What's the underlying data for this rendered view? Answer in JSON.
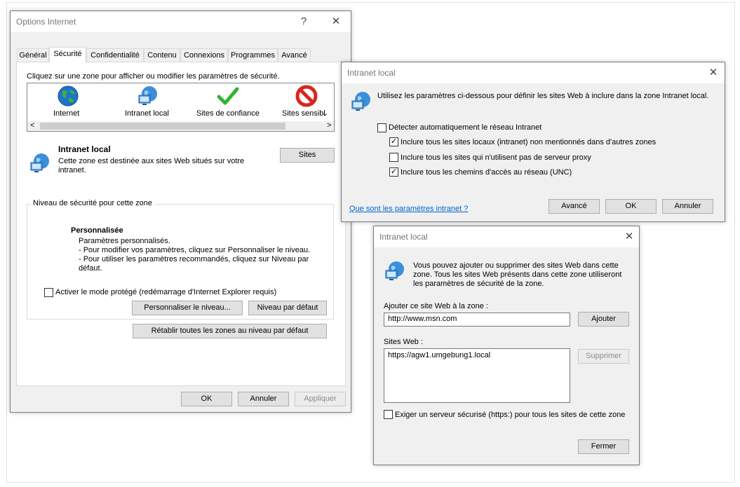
{
  "options_dialog": {
    "title": "Options Internet",
    "help_glyph": "?",
    "close_glyph": "✕",
    "tabs": [
      "Général",
      "Sécurité",
      "Confidentialité",
      "Contenu",
      "Connexions",
      "Programmes",
      "Avancé"
    ],
    "active_tab": "Sécurité",
    "zone_instruction": "Cliquez sur une zone pour afficher ou modifier les paramètres de sécurité.",
    "zones": [
      {
        "label": "Internet",
        "icon": "globe-icon"
      },
      {
        "label": "Intranet local",
        "icon": "intranet-globe-icon"
      },
      {
        "label": "Sites de confiance",
        "icon": "checkmark-icon"
      },
      {
        "label": "Sites sensibl",
        "icon": "restricted-icon"
      }
    ],
    "scroll_left": "<",
    "scroll_right": ">",
    "selected_zone_title": "Intranet local",
    "selected_zone_desc": "Cette zone est destinée aux sites Web situés sur votre intranet.",
    "sites_button": "Sites",
    "security_level_group": "Niveau de sécurité pour cette zone",
    "level_title": "Personnalisée",
    "level_lines": [
      "Paramètres personnalisés.",
      "- Pour modifier vos paramètres, cliquez sur Personnaliser le niveau.",
      "- Pour utiliser les paramètres recommandés, cliquez sur Niveau par défaut."
    ],
    "protected_mode_label": "Activer le mode protégé (redémarrage d'Internet Explorer requis)",
    "protected_mode_checked": false,
    "customize_button": "Personnaliser le niveau...",
    "default_level_button": "Niveau par défaut",
    "reset_all_button": "Rétablir toutes les zones au niveau par défaut",
    "ok_button": "OK",
    "cancel_button": "Annuler",
    "apply_button": "Appliquer"
  },
  "intranet_dialog": {
    "title": "Intranet local",
    "close_glyph": "✕",
    "intro": "Utilisez les paramètres ci-dessous pour définir les sites Web à inclure dans la zone Intranet local.",
    "options": [
      {
        "label": "Détecter automatiquement le réseau Intranet",
        "checked": false
      },
      {
        "label": "Inclure tous les sites locaux (intranet) non mentionnés dans d'autres zones",
        "checked": true
      },
      {
        "label": "Inclure tous les sites qui n'utilisent pas de serveur proxy",
        "checked": false
      },
      {
        "label": "Inclure tous les chemins d'accès au réseau (UNC)",
        "checked": true
      }
    ],
    "help_link": "Que sont les paramètres intranet ?",
    "advanced_button": "Avancé",
    "ok_button": "OK",
    "cancel_button": "Annuler"
  },
  "sites_dialog": {
    "title": "Intranet local",
    "close_glyph": "✕",
    "intro": "Vous pouvez ajouter ou supprimer des sites Web dans cette zone. Tous les sites Web présents dans cette zone utiliseront les paramètres de sécurité de la zone.",
    "add_label": "Ajouter ce site Web à la zone :",
    "add_value": "http://www.msn.com",
    "add_button": "Ajouter",
    "sites_label": "Sites Web :",
    "sites": [
      "https://agw1.umgebung1.local"
    ],
    "remove_button": "Supprimer",
    "https_label": "Exiger un serveur sécurisé (https:) pour tous les sites de cette zone",
    "https_checked": false,
    "close_button": "Fermer"
  },
  "colors": {
    "dialog_bg": "#f0f0f0",
    "link": "#0066cc",
    "check_green": "#2fb52f",
    "restricted_red": "#d9261c",
    "globe_blue": "#1e74c9"
  }
}
